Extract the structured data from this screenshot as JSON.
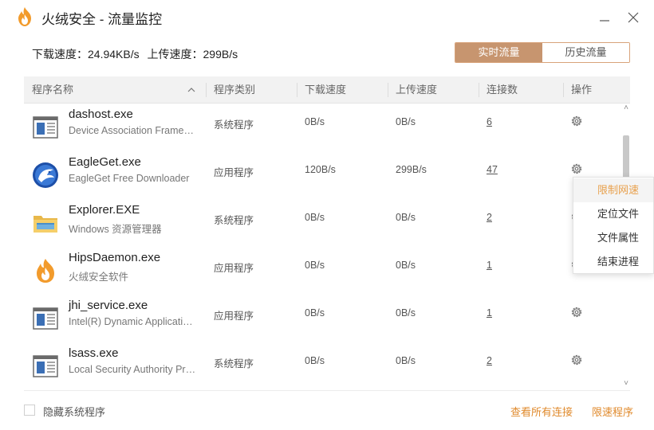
{
  "window": {
    "title": "火绒安全 - 流量监控",
    "logo_icon": "huorong-flame-icon",
    "accent": "#c7956f",
    "link_color": "#e08a2c"
  },
  "summary": {
    "download_label": "下载速度：",
    "download_value": "24.94KB/s",
    "upload_label": "上传速度：",
    "upload_value": "299B/s"
  },
  "tabs": [
    {
      "label": "实时流量",
      "active": true
    },
    {
      "label": "历史流量",
      "active": false
    }
  ],
  "table": {
    "columns": [
      "程序名称",
      "程序类别",
      "下载速度",
      "上传速度",
      "连接数",
      "操作"
    ],
    "rows": [
      {
        "name": "dashost.exe",
        "desc": "Device Association Framework",
        "type": "系统程序",
        "down": "0B/s",
        "up": "0B/s",
        "conn": "6",
        "icon": "window-app-icon"
      },
      {
        "name": "EagleGet.exe",
        "desc": "EagleGet Free Downloader",
        "type": "应用程序",
        "down": "120B/s",
        "up": "299B/s",
        "conn": "47",
        "icon": "eagle-icon"
      },
      {
        "name": "Explorer.EXE",
        "desc": "Windows 资源管理器",
        "type": "系统程序",
        "down": "0B/s",
        "up": "0B/s",
        "conn": "2",
        "icon": "folder-icon"
      },
      {
        "name": "HipsDaemon.exe",
        "desc": "火绒安全软件",
        "type": "应用程序",
        "down": "0B/s",
        "up": "0B/s",
        "conn": "1",
        "icon": "huorong-flame-icon"
      },
      {
        "name": "jhi_service.exe",
        "desc": "Intel(R) Dynamic Application Loader",
        "type": "应用程序",
        "down": "0B/s",
        "up": "0B/s",
        "conn": "1",
        "icon": "window-app-icon"
      },
      {
        "name": "lsass.exe",
        "desc": "Local Security Authority Process",
        "type": "系统程序",
        "down": "0B/s",
        "up": "0B/s",
        "conn": "2",
        "icon": "window-app-icon"
      }
    ]
  },
  "context_menu": [
    "限制网速",
    "定位文件",
    "文件属性",
    "结束进程"
  ],
  "footer": {
    "hide_system_label": "隐藏系统程序",
    "view_all_label": "查看所有连接",
    "limit_label": "限速程序"
  }
}
